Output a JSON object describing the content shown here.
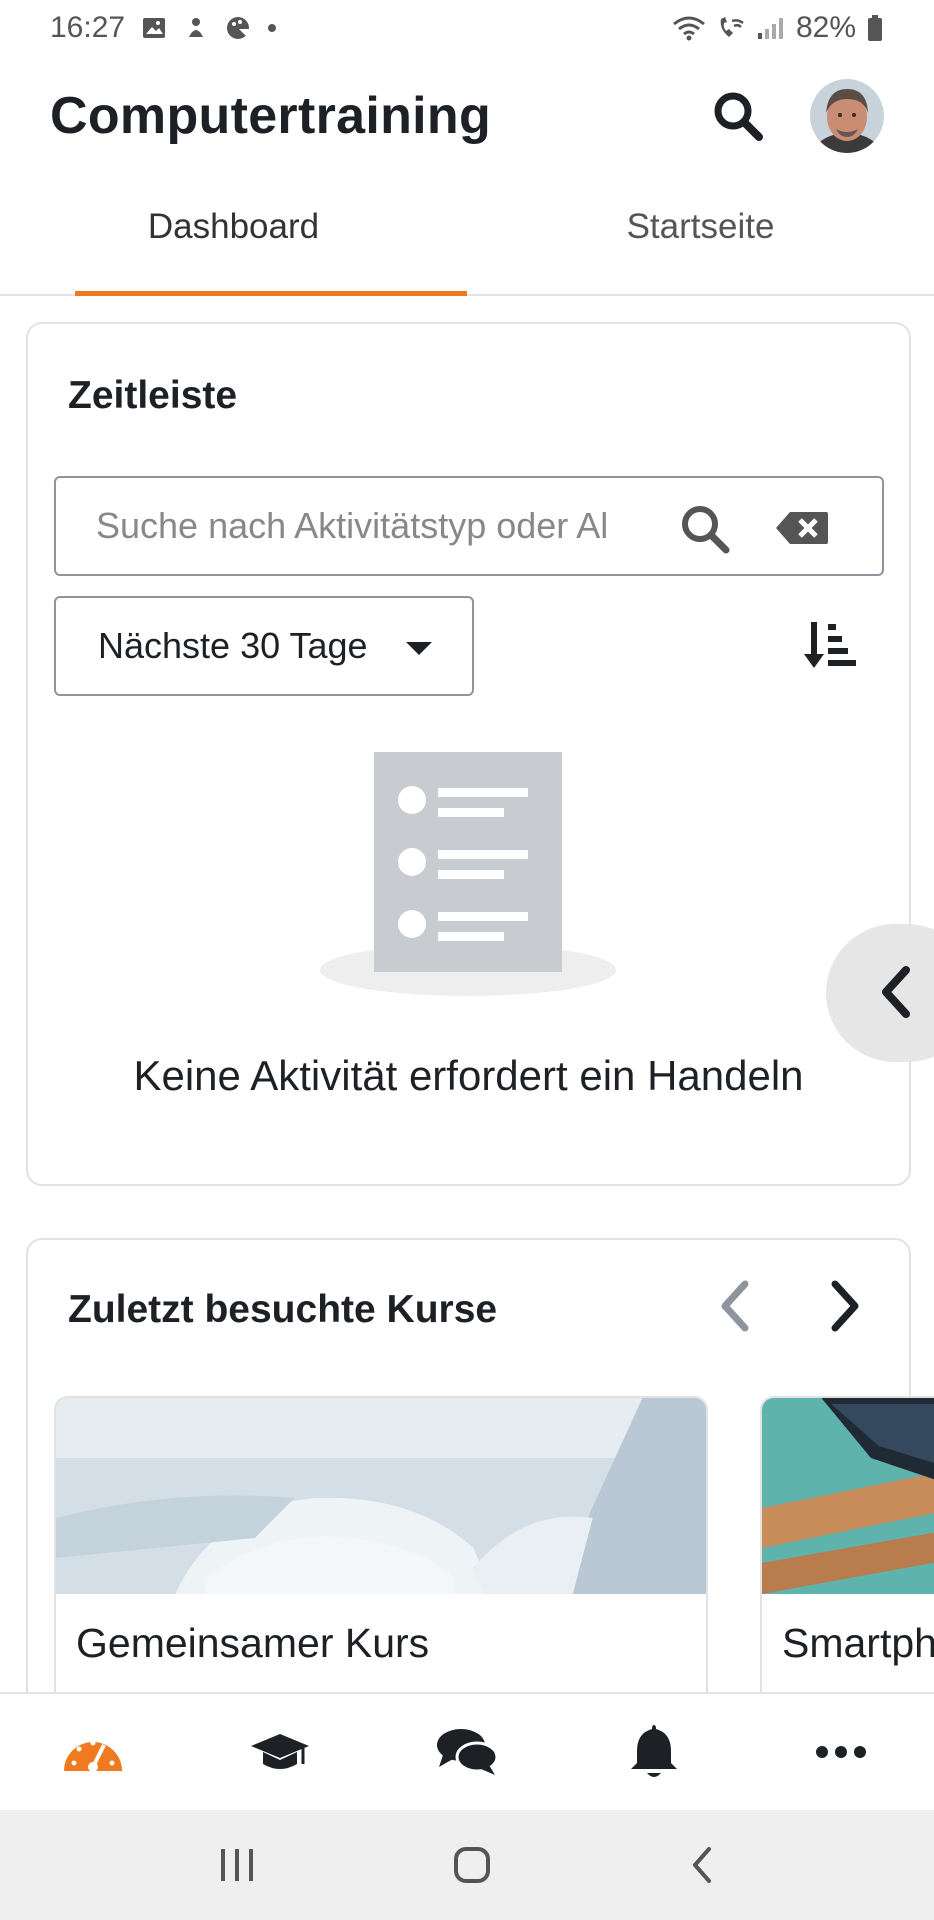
{
  "status_bar": {
    "time": "16:27",
    "battery": "82%"
  },
  "header": {
    "title": "Computertraining"
  },
  "tabs": [
    {
      "label": "Dashboard",
      "active": true
    },
    {
      "label": "Startseite",
      "active": false
    }
  ],
  "timeline": {
    "title": "Zeitleiste",
    "search_placeholder": "Suche nach Aktivitätstyp oder Al",
    "filter_value": "Nächste 30 Tage",
    "empty_message": "Keine Aktivität erfordert ein Handeln"
  },
  "recent_courses": {
    "title": "Zuletzt besuchte Kurse",
    "courses": [
      {
        "name": "Gemeinsamer Kurs"
      },
      {
        "name": "Smartphone"
      }
    ]
  },
  "bottom_nav": {
    "items": [
      "dashboard-icon",
      "courses-icon",
      "messages-icon",
      "notifications-icon",
      "more-icon"
    ],
    "active_color": "#f07a20"
  },
  "colors": {
    "accent": "#f07a20",
    "text": "#1d2125",
    "illustration": "#c8cbcf"
  }
}
